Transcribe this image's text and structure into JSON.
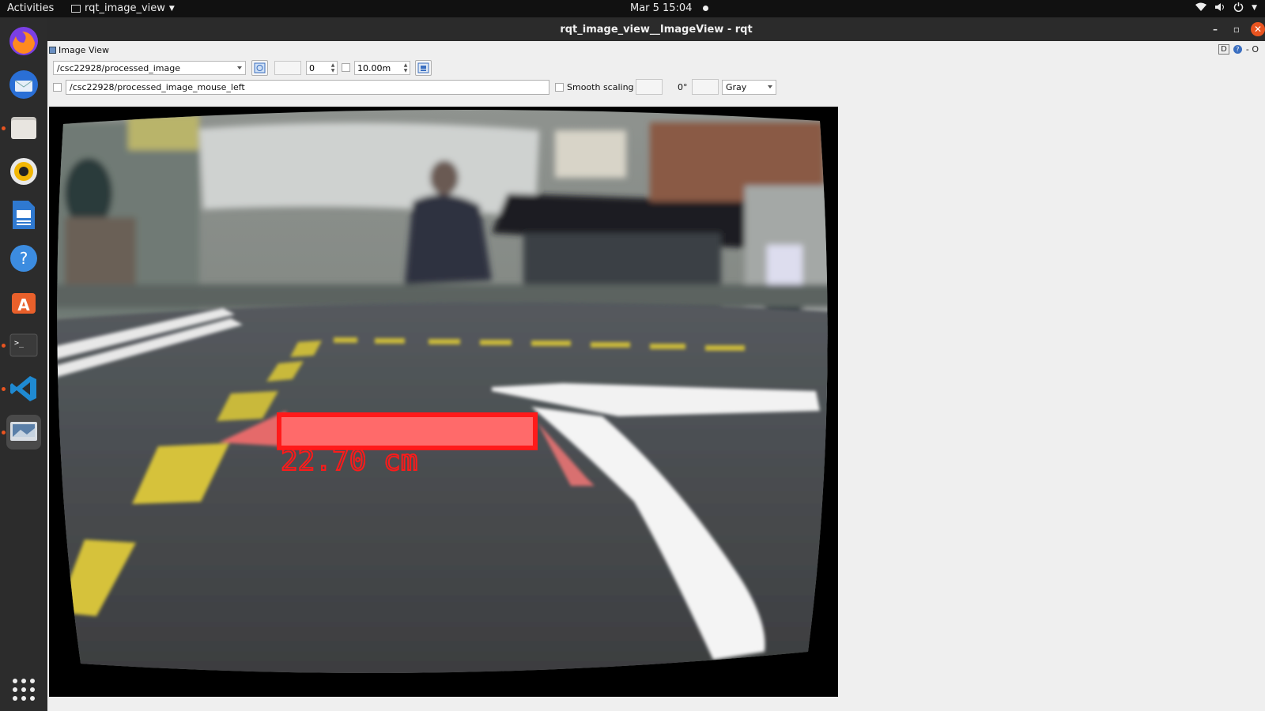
{
  "topbar": {
    "activities": "Activities",
    "app_name": "rqt_image_view",
    "date": "Mar 5",
    "time": "15:04"
  },
  "dock": {
    "items": [
      "firefox-icon",
      "thunderbird-icon",
      "files-icon",
      "rhythmbox-icon",
      "writer-icon",
      "help-icon",
      "software-icon",
      "terminal-icon",
      "vscode-icon",
      "image-viewer-icon"
    ]
  },
  "window": {
    "title": "rqt_image_view__ImageView - rqt"
  },
  "plugin": {
    "title": "Image View",
    "ctrl_label": "D",
    "ctrl_right": "- O"
  },
  "toolbar": {
    "topic": "/csc22928/processed_image",
    "spin_value": "0",
    "max_range": "10.00m",
    "mouse_topic": "/csc22928/processed_image_mouse_left",
    "smooth_label": "Smooth scaling",
    "rotation": "0°",
    "color_mode": "Gray"
  },
  "image": {
    "overlay_text": "22.70  cm",
    "colors": {
      "overlay": "#ff1a1a",
      "lane_yellow": "#d6c23a",
      "lane_white": "#f4f4f4"
    }
  }
}
